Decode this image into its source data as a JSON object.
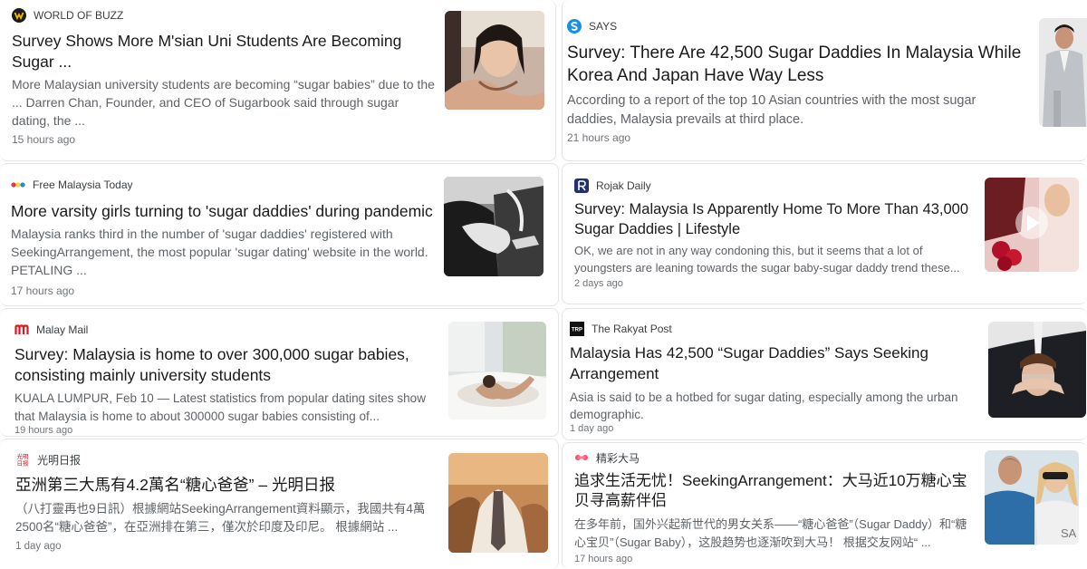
{
  "articles": [
    {
      "source": "WORLD OF BUZZ",
      "title": "Survey Shows More M'sian Uni Students Are Becoming Sugar ...",
      "snippet": "More Malaysian university students are becoming “sugar babies” due to the ... Darren Chan, Founder, and CEO of Sugarbook said through sugar dating, the ...",
      "time": "15 hours ago",
      "logo_icon": "worldofbuzz-logo-icon",
      "thumb_icon": "couple-photo-thumbnail"
    },
    {
      "source": "SAYS",
      "title": "Survey: There Are 42,500 Sugar Daddies In Malaysia While Korea And Japan Have Way Less",
      "snippet": "According to a report of the top 10 Asian countries with the most sugar daddies, Malaysia prevails at third place.",
      "time": "21 hours ago",
      "logo_icon": "says-logo-icon",
      "thumb_icon": "man-in-suit-thumbnail"
    },
    {
      "source": "Free Malaysia Today",
      "title": "More varsity girls turning to 'sugar daddies' during pandemic",
      "snippet": "Malaysia ranks third in the number of 'sugar daddies' registered with SeekingArrangement, the most popular 'sugar dating' website in the world. PETALING ...",
      "time": "17 hours ago",
      "logo_icon": "fmt-logo-icon",
      "thumb_icon": "black-white-couple-thumbnail"
    },
    {
      "source": "Rojak Daily",
      "title": "Survey: Malaysia Is Apparently Home To More Than 43,000 Sugar Daddies | Lifestyle",
      "snippet": "OK, we are not in any way condoning this, but it seems that a lot of youngsters are leaning towards the sugar baby-sugar daddy trend these...",
      "time": "2 days ago",
      "logo_icon": "rojakdaily-logo-icon",
      "thumb_icon": "roses-video-thumbnail"
    },
    {
      "source": "Malay Mail",
      "title": "Survey: Malaysia is home to over 300,000 sugar babies, consisting mainly university students",
      "snippet": "KUALA LUMPUR, Feb 10 — Latest statistics from popular dating sites show that Malaysia is home to about 300000 sugar babies consisting of...",
      "time": "19 hours ago",
      "logo_icon": "malaymail-logo-icon",
      "thumb_icon": "bathtub-thumbnail"
    },
    {
      "source": "The Rakyat Post",
      "title": "Malaysia Has 42,500 “Sugar Daddies” Says Seeking Arrangement",
      "snippet": "Asia is said to be a hotbed for sugar dating, especially among the urban demographic.",
      "time": "1 day ago",
      "logo_icon": "therakyatpost-logo-icon",
      "logo_text": "TRP",
      "thumb_icon": "blindfold-thumbnail"
    },
    {
      "source": "光明日报",
      "title": "亞洲第三大馬有4.2萬名“糖心爸爸” – 光明日报",
      "snippet": "（八打靈再也9日訊）根據網站SeekingArrangement資料顯示，我國共有4萬2500名“糖心爸爸”，在亞洲排在第三，僅次於印度及印尼。 根據網站 ...",
      "time": "1 day ago",
      "logo_icon": "guangming-logo-icon",
      "logo_text": "光明\n日报",
      "thumb_icon": "man-tie-thumbnail"
    },
    {
      "source": "精彩大马",
      "title": "追求生活无忧！SeekingArrangement：大马近10万糖心宝贝寻高薪伴侣",
      "snippet": "在多年前，国外兴起新世代的男女关系——“糖心爸爸”（Sugar Daddy）和“糖心宝贝”（Sugar Baby），这股趋势也逐渐吹到大马！ 根据交友网站“ ...",
      "time": "17 hours ago",
      "logo_icon": "jingcaidama-logo-icon",
      "thumb_icon": "couple-selfie-thumbnail",
      "thumb_text": "SA"
    }
  ]
}
